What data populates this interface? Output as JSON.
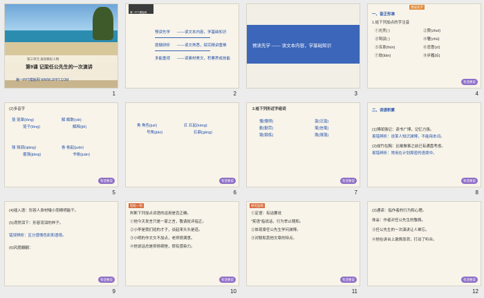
{
  "slides": [
    {
      "n": "1",
      "unit": "第三单元 再现精彩人物",
      "title": "第9课 记梁任公先生的一次演讲",
      "footer": "第一PPT模板网 WWW.1PPT.COM"
    },
    {
      "n": "2",
      "topbar": "第一PPT模板网",
      "lines": [
        [
          "预读先学",
          "——读文本内容，学基础知识"
        ],
        [
          "提疑研析",
          "——读文熟悉，探究精讲重难"
        ],
        [
          "多能重视",
          "——读素材美文，积累养成技能"
        ]
      ]
    },
    {
      "n": "3",
      "text": "预读先学 —— 读文本内容，学基础知识"
    },
    {
      "n": "4",
      "header": "预读先学",
      "h1": "一、音正形准",
      "h2": "1.给下列加点的字注音",
      "items": [
        "①光秃(  )",
        "②赘(zhuì)",
        "③驾驭(  )",
        "④箸(zhù)",
        "⑤浑身(hún)",
        "⑥恣意(zì)",
        "⑦敛(liǎn)",
        "⑧步履(lǚ)"
      ],
      "badge": "有话要说"
    },
    {
      "n": "5",
      "head": "(2)多音字",
      "groups": [
        [
          "笼 笼罩(lǒng)",
          "笼子(lóng)"
        ],
        [
          "解 解数(xiè)",
          "解释(jiě)"
        ],
        [
          "强 强调(qiáng)",
          "倔强(jiàng)"
        ],
        [
          "卷 卷起(juǎn)",
          "书卷(juàn)"
        ]
      ],
      "badge": "有话要说"
    },
    {
      "n": "6",
      "groups": [
        [
          "角 角色(jué)",
          "号角(jiǎo)"
        ],
        [
          "扛 扛起(káng)",
          "扛鼎(gāng)"
        ]
      ],
      "badge": "有话要说"
    },
    {
      "n": "7",
      "head": "2.给下列形近字组词",
      "items": [
        "懂(懂得)",
        "勤(勤劳)",
        "锻(锻炼)",
        "滥(泛滥)",
        "笺(信笺)",
        "溅(溅落)"
      ],
      "badge": "有话要说"
    },
    {
      "n": "8",
      "h1": "二、词语积累",
      "items": [
        "(1)博闻强记：读书广博，记忆力强。",
        "易错辨析：说某人知识渊博，不能用本词。",
        "(2)成竹在胸：比喻做事之前已有通盘考虑。",
        "易错辨析：常用在计划周密的语境中。"
      ],
      "badge": "有话要说"
    },
    {
      "n": "9",
      "items": [
        "(4)插入语：形容人身材矮小而精明能干。",
        "(5)潸然泪下：形容流泪的样子。",
        "错误辨析：区分感情色彩和语境。",
        "(6)风度翩翩："
      ],
      "badge": "有话要说"
    },
    {
      "n": "10",
      "tag": "轻松一刻",
      "items": [
        "判断下列加点词语的运用是否正确。",
        "①他今天发言只是一家之言，敬请批评指正。",
        "②小李是我们班的才子，谈起来头头是道。",
        "③小明的作文文不加点，老师很满意。",
        "④他说话总是抑扬顿挫，很有感染力。"
      ],
      "badge": "有话要说"
    },
    {
      "n": "11",
      "tag": "探究园地",
      "items": [
        "①定语：有话要说",
        "\"笑语\"指说话，行为举止随和。",
        "②体现梁任公先生学问渊博。",
        "③对联和其他文章的特点。"
      ],
      "badge": "有话要说"
    },
    {
      "n": "12",
      "items": [
        "(2)通读：指作者的行为和心理。",
        "体会：作者对任公先生的敬佩。",
        "③任公先生的一次演讲让人难忘。",
        "④他在讲台上激情澎湃，打动了听众。"
      ],
      "badge": "有话要说"
    }
  ]
}
